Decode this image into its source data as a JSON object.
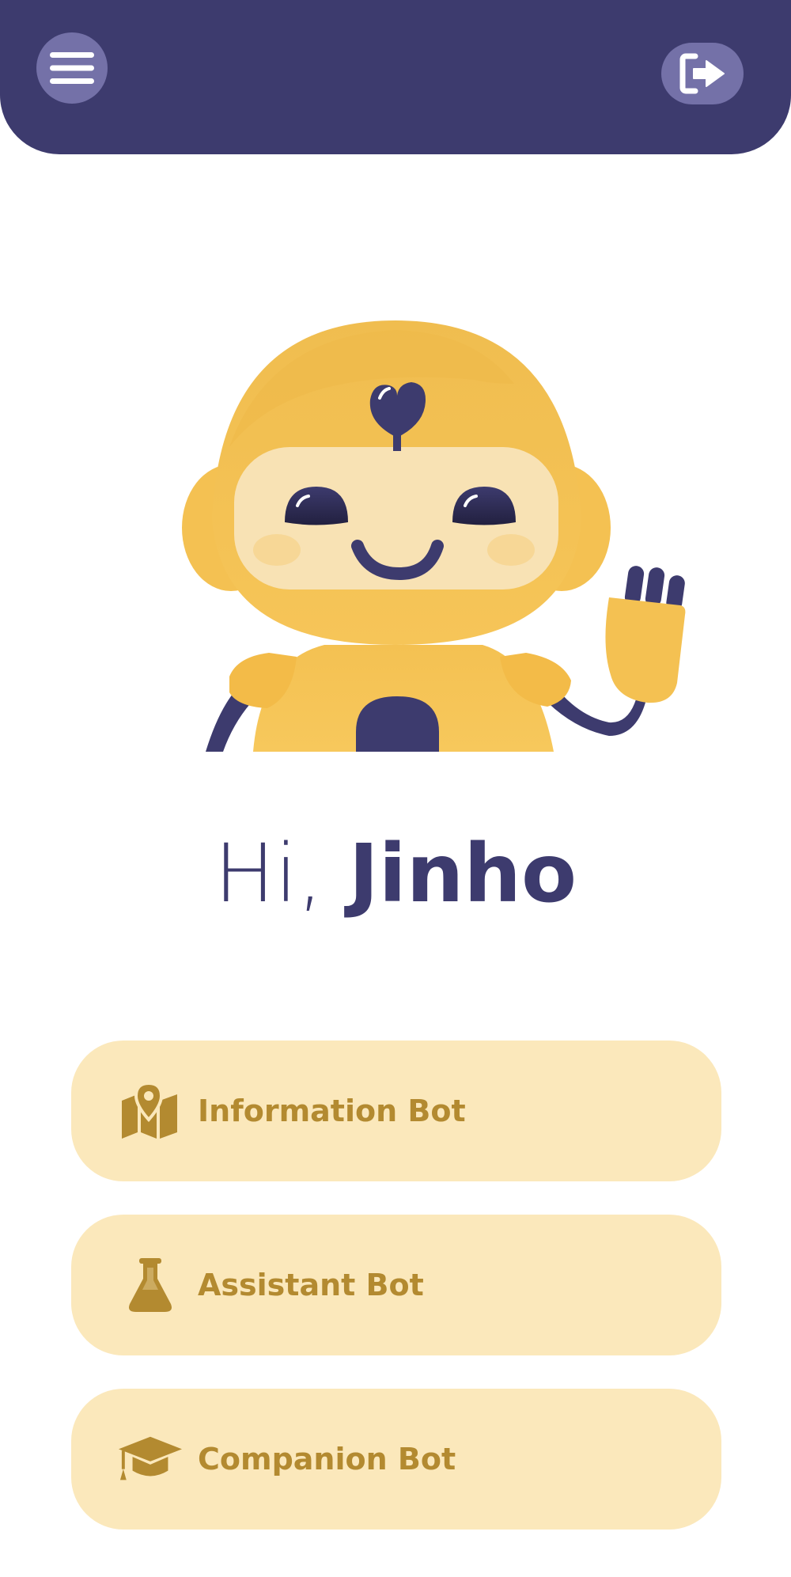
{
  "header": {
    "menu_icon": "hamburger-menu-icon",
    "logout_icon": "logout-icon"
  },
  "greeting": {
    "prefix": "Hi,",
    "name": "Jinho"
  },
  "bots": [
    {
      "label": "Information Bot",
      "icon": "map-pin-icon"
    },
    {
      "label": "Assistant Bot",
      "icon": "flask-icon"
    },
    {
      "label": "Companion Bot",
      "icon": "graduation-cap-icon"
    }
  ],
  "colors": {
    "primary": "#3d3b6e",
    "header_button": "#7471a8",
    "bot_button_bg": "#fbe8bb",
    "bot_button_text": "#b38a30",
    "robot_yellow": "#f4c152"
  }
}
